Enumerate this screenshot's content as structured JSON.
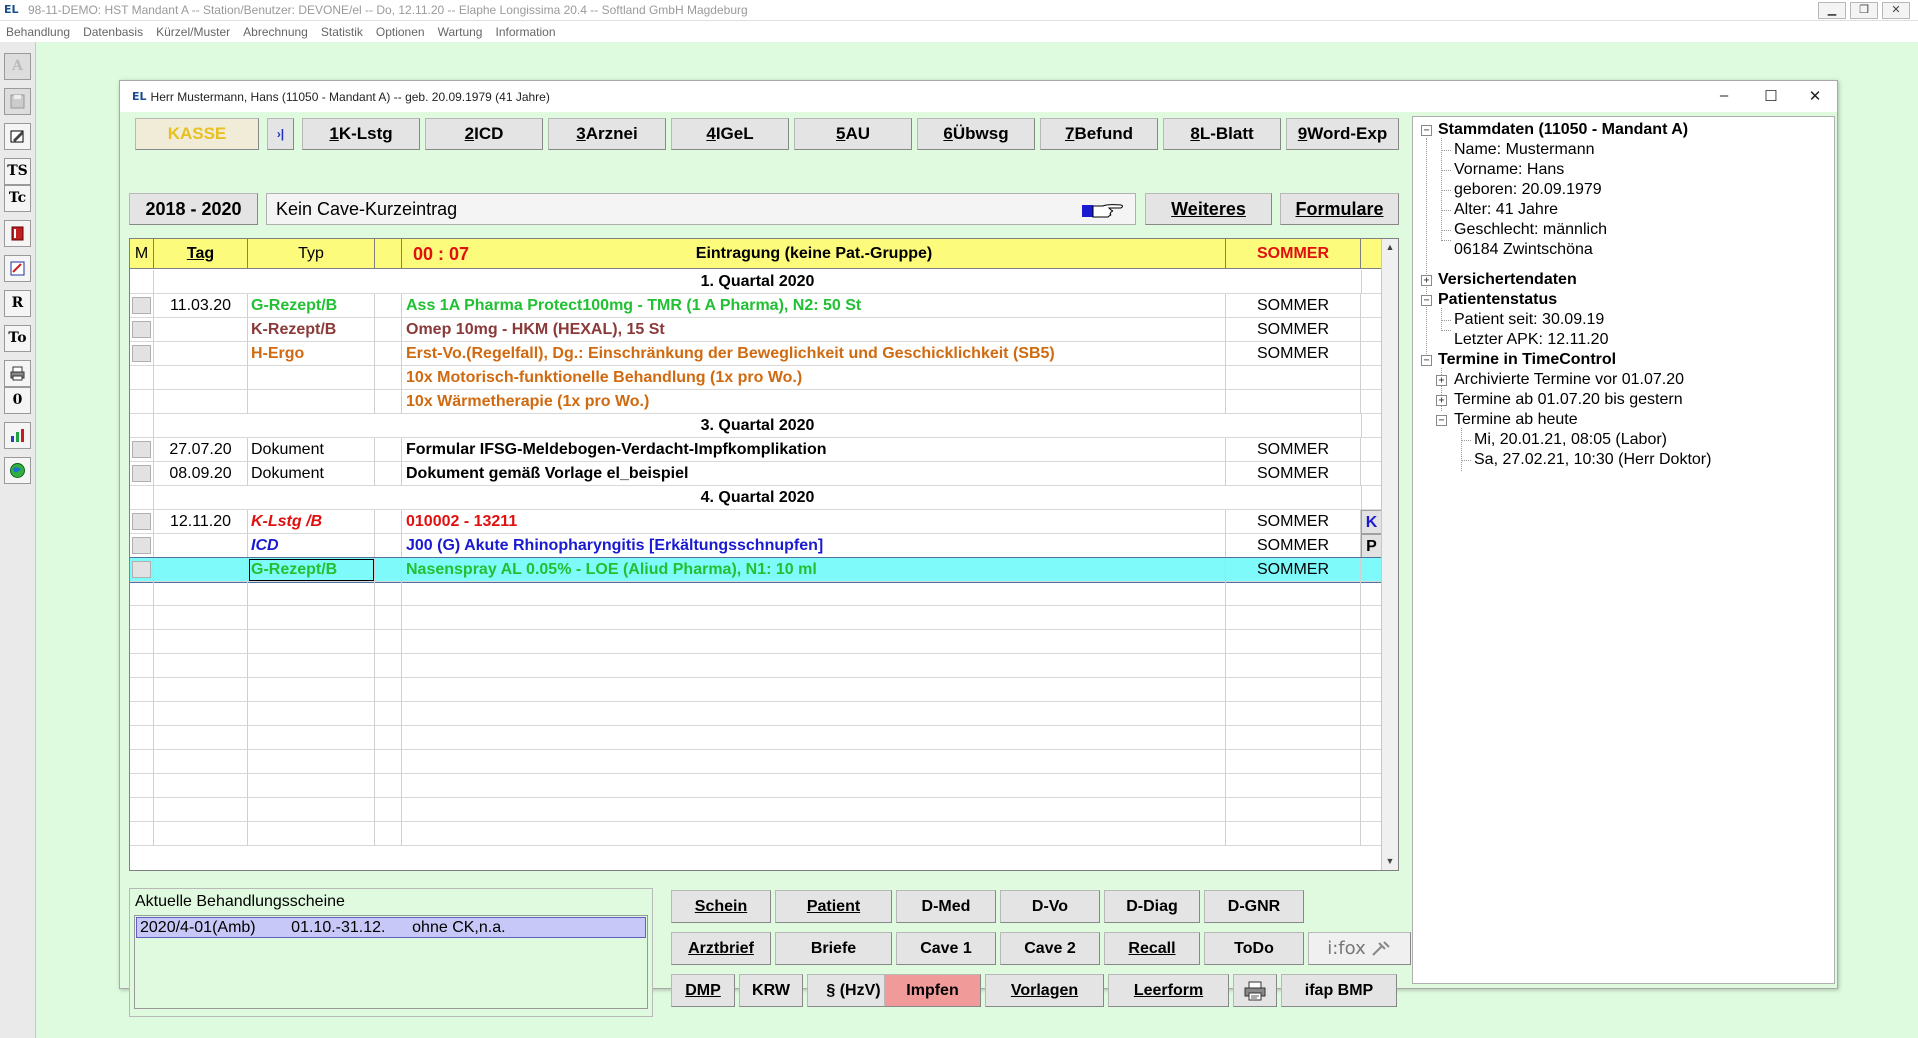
{
  "app": {
    "title": "98-11-DEMO: HST Mandant A -- Station/Benutzer: DEVONE/el -- Do, 12.11.20 -- Elaphe Longissima 20.4 -- Softland GmbH Magdeburg",
    "logo": "EL",
    "menu": [
      "Behandlung",
      "Datenbasis",
      "Kürzel/Muster",
      "Abrechnung",
      "Statistik",
      "Optionen",
      "Wartung",
      "Information"
    ]
  },
  "left_toolbar": [
    "A",
    "",
    "",
    "TS",
    "Tc",
    "",
    "",
    "R",
    "To",
    "",
    "0",
    "",
    ""
  ],
  "window": {
    "title": "Herr Mustermann, Hans (11050 - Mandant A) -- geb. 20.09.1979 (41 Jahre)",
    "logo": "EL"
  },
  "tabs": {
    "kasse": "KASSE",
    "jump": "›|",
    "items": [
      {
        "key": "1",
        "label": " K-Lstg"
      },
      {
        "key": "2",
        "label": " ICD"
      },
      {
        "key": "3",
        "label": " Arznei"
      },
      {
        "key": "4",
        "label": " IGeL"
      },
      {
        "key": "5",
        "label": " AU"
      },
      {
        "key": "6",
        "label": " Übwsg"
      },
      {
        "key": "7",
        "label": " Befund"
      },
      {
        "key": "8",
        "label": " L-Blatt"
      },
      {
        "key": "9",
        "label": " Word-Exp"
      }
    ]
  },
  "toolbar2": {
    "year_range": "2018 - 2020",
    "cave_text": "Kein Cave-Kurzeintrag",
    "weiteres": "Weiteres",
    "formulare": "Formulare"
  },
  "grid": {
    "headers": {
      "m": "M",
      "tag": "Tag",
      "typ": "Typ",
      "time": "00 : 07",
      "eintrag": "Eintragung (keine Pat.-Gruppe)",
      "user": "SOMMER"
    },
    "rows": [
      {
        "kind": "section",
        "text": "1. Quartal 2020"
      },
      {
        "kind": "entry",
        "box": true,
        "tag": "11.03.20",
        "typ": "G-Rezept/B",
        "text": "Ass 1A Pharma Protect100mg - TMR (1 A Pharma), N2: 50 St",
        "user": "SOMMER",
        "flag": "",
        "color": "green"
      },
      {
        "kind": "entry",
        "box": true,
        "tag": "",
        "typ": "K-Rezept/B",
        "text": "Omep 10mg - HKM (HEXAL), 15 St",
        "user": "SOMMER",
        "flag": "",
        "color": "brown"
      },
      {
        "kind": "entry",
        "box": true,
        "tag": "",
        "typ": "H-Ergo",
        "text": "Erst-Vo.(Regelfall), Dg.: Einschränkung der Beweglichkeit und Geschicklichkeit (SB5)",
        "user": "SOMMER",
        "flag": "",
        "color": "orange"
      },
      {
        "kind": "entry",
        "box": false,
        "tag": "",
        "typ": "",
        "text": "10x Motorisch-funktionelle Behandlung (1x pro Wo.)",
        "user": "",
        "flag": "",
        "color": "orange"
      },
      {
        "kind": "entry",
        "box": false,
        "tag": "",
        "typ": "",
        "text": "10x Wärmetherapie (1x pro Wo.)",
        "user": "",
        "flag": "",
        "color": "orange"
      },
      {
        "kind": "section",
        "text": "3. Quartal 2020"
      },
      {
        "kind": "entry",
        "box": true,
        "tag": "27.07.20",
        "typ": "Dokument",
        "text": "Formular IFSG-Meldebogen-Verdacht-Impfkomplikation",
        "user": "SOMMER",
        "flag": "",
        "color": "normal",
        "flagbox": true
      },
      {
        "kind": "entry",
        "box": true,
        "tag": "08.09.20",
        "typ": "Dokument",
        "text": "Dokument gemäß Vorlage el_beispiel",
        "user": "SOMMER",
        "flag": "",
        "color": "normal",
        "flagbox": true
      },
      {
        "kind": "section",
        "text": "4. Quartal 2020"
      },
      {
        "kind": "entry",
        "box": true,
        "tag": "12.11.20",
        "typ": "K-Lstg /B",
        "text": "010002 - 13211",
        "user": "SOMMER",
        "flag": "K",
        "color": "red"
      },
      {
        "kind": "entry",
        "box": true,
        "tag": "",
        "typ": "ICD",
        "text": "J00 (G)  Akute Rhinopharyngitis [Erkältungsschnupfen]",
        "user": "SOMMER",
        "flag": "P",
        "color": "blue"
      },
      {
        "kind": "entry",
        "box": true,
        "tag": "",
        "typ": "G-Rezept/B",
        "text": "Nasenspray AL 0.05% - LOE (Aliud Pharma), N1: 10 ml",
        "user": "SOMMER",
        "flag": "",
        "color": "green",
        "selected": true
      }
    ]
  },
  "scheine": {
    "label": "Aktuelle Behandlungsscheine",
    "selected": "2020/4-01(Amb)        01.10.-31.12.      ohne CK,n.a."
  },
  "bottom_buttons": {
    "row1": [
      "Schein",
      "Patient",
      "D-Med",
      "D-Vo",
      "D-Diag",
      "D-GNR"
    ],
    "row2": [
      "Arztbrief",
      "Briefe",
      "Cave 1",
      "Cave 2",
      "Recall",
      "ToDo"
    ],
    "ifox": "i:fox",
    "row3": [
      "DMP",
      "KRW",
      "§ (HzV)",
      "Impfen",
      "Vorlagen",
      "Leerform",
      "",
      "ifap BMP"
    ]
  },
  "tree": {
    "stammdaten": "Stammdaten (11050 - Mandant A)",
    "stamm_items": [
      "Name: Mustermann",
      "Vorname: Hans",
      "geboren: 20.09.1979",
      "Alter: 41 Jahre",
      "Geschlecht: männlich",
      "06184 Zwintschöna"
    ],
    "versicherten": "Versichertendaten",
    "patientenstatus": "Patientenstatus",
    "status_items": [
      "Patient seit: 30.09.19",
      "Letzter APK: 12.11.20"
    ],
    "termine": "Termine in TimeControl",
    "termine_items": [
      "Archivierte Termine vor 01.07.20",
      "Termine ab 01.07.20 bis gestern",
      "Termine ab heute"
    ],
    "heute_items": [
      "Mi, 20.01.21, 08:05 (Labor)",
      "Sa, 27.02.21, 10:30 (Herr Doktor)"
    ]
  },
  "colors": {
    "background": "#dffbdf",
    "grid_header": "#fdfb7c",
    "selected_row": "#7ffafa",
    "impfen_button": "#f09a9a",
    "kasse": "#e8c020"
  }
}
